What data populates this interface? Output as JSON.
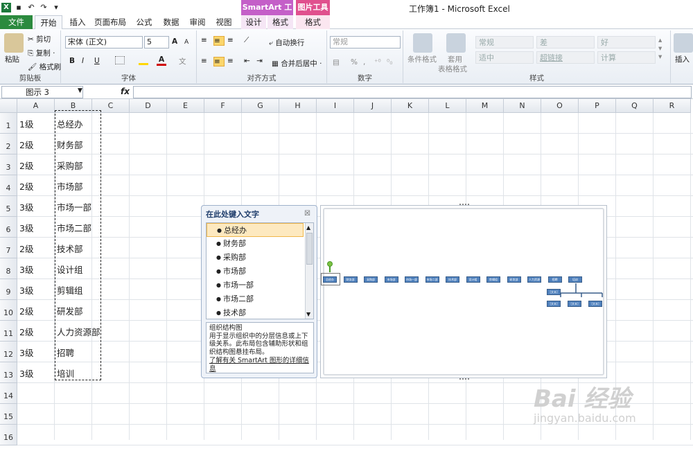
{
  "window": {
    "title": "工作簿1 - Microsoft Excel",
    "context_smartart": "SmartArt 工具",
    "context_picture": "图片工具"
  },
  "tabs": {
    "file": "文件",
    "home": "开始",
    "insert": "插入",
    "layout": "页面布局",
    "formula": "公式",
    "data": "数据",
    "review": "审阅",
    "view": "视图",
    "design": "设计",
    "format1": "格式",
    "format2": "格式"
  },
  "ribbon": {
    "clipboard": {
      "label": "剪贴板",
      "paste": "粘贴",
      "cut": "剪切",
      "copy": "复制 ·",
      "format_painter": "格式刷"
    },
    "font": {
      "label": "字体",
      "name": "宋体 (正文)",
      "size": "5",
      "bold": "B",
      "italic": "I",
      "underline": "U",
      "grow": "A",
      "shrink": "A"
    },
    "alignment": {
      "label": "对齐方式",
      "wrap": "自动换行",
      "merge": "合并后居中 ·"
    },
    "number": {
      "label": "数字",
      "format": "常规",
      "percent": "%",
      "comma": ","
    },
    "styles": {
      "label": "样式",
      "conditional": "条件格式",
      "table": "套用",
      "table2": "表格格式",
      "normal": "常规",
      "bad": "差",
      "good": "好",
      "neutral": "适中",
      "hyperlink": "超链接",
      "calc": "计算"
    },
    "cells": {
      "insert": "插入"
    }
  },
  "formula_bar": {
    "name_box": "图示 3",
    "fx": "fx"
  },
  "columns": [
    "A",
    "B",
    "C",
    "D",
    "E",
    "F",
    "G",
    "H",
    "I",
    "J",
    "K",
    "L",
    "M",
    "N",
    "O",
    "P",
    "Q",
    "R"
  ],
  "rows": [
    "1",
    "2",
    "3",
    "4",
    "5",
    "6",
    "7",
    "8",
    "9",
    "10",
    "11",
    "12",
    "13",
    "14",
    "15",
    "16"
  ],
  "cells": [
    {
      "a": "1级",
      "b": "总经办"
    },
    {
      "a": "2级",
      "b": "财务部"
    },
    {
      "a": "2级",
      "b": "采购部"
    },
    {
      "a": "2级",
      "b": "市场部"
    },
    {
      "a": "3级",
      "b": "市场一部"
    },
    {
      "a": "3级",
      "b": "市场二部"
    },
    {
      "a": "2级",
      "b": "技术部"
    },
    {
      "a": "3级",
      "b": "设计组"
    },
    {
      "a": "3级",
      "b": "剪辑组"
    },
    {
      "a": "2级",
      "b": "研发部"
    },
    {
      "a": "2级",
      "b": "人力资源部"
    },
    {
      "a": "3级",
      "b": "招聘"
    },
    {
      "a": "3级",
      "b": "培训"
    }
  ],
  "text_pane": {
    "title": "在此处键入文字",
    "close": "☒",
    "items": [
      "总经办",
      "财务部",
      "采购部",
      "市场部",
      "市场一部",
      "市场二部",
      "技术部"
    ],
    "desc_title": "组织结构图",
    "desc_body": "用于显示组织中的分层信息或上下级关系。此布局包含辅助形状和组织结构图悬挂布局。",
    "link": "了解有关 SmartArt 图形的详细信息"
  },
  "smartart_nodes": [
    "总经办",
    "财务部",
    "采购部",
    "市场部",
    "市场一部",
    "市场二部",
    "技术部",
    "设计组",
    "剪辑组",
    "研发部",
    "人力资源部",
    "招聘",
    "培训",
    "[文本]",
    "[文本]",
    "[文本]",
    "[文本]"
  ],
  "watermark": {
    "big": "Bai 经验",
    "small": "jingyan.baidu.com"
  }
}
